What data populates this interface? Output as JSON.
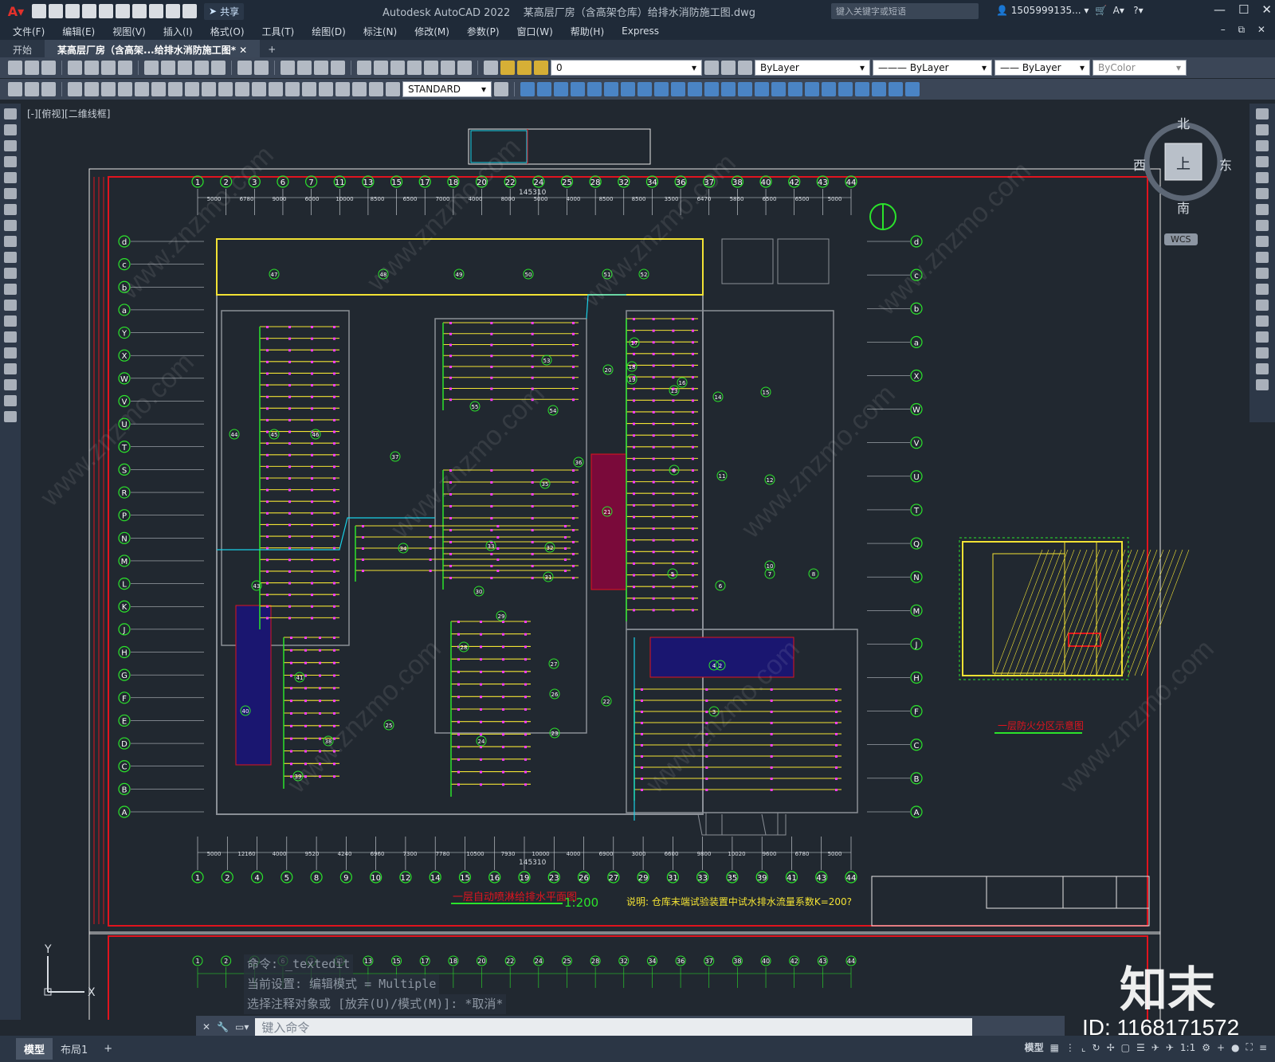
{
  "title_bar": {
    "app_title": "Autodesk AutoCAD 2022",
    "doc_title": "某高层厂房（含高架仓库）给排水消防施工图.dwg",
    "search_placeholder": "键入关键字或短语",
    "user": "1505999135...",
    "share_label": "共享"
  },
  "menu": {
    "items": [
      "文件(F)",
      "编辑(E)",
      "视图(V)",
      "插入(I)",
      "格式(O)",
      "工具(T)",
      "绘图(D)",
      "标注(N)",
      "修改(M)",
      "参数(P)",
      "窗口(W)",
      "帮助(H)",
      "Express"
    ]
  },
  "tabs": {
    "start": "开始",
    "doc": "某高层厂房（含高架...给排水消防施工图*"
  },
  "toolbar": {
    "layer_value": "0",
    "color_value": "ByLayer",
    "linetype_value": "ByLayer",
    "lineweight_value": "ByLayer",
    "plotstyle_value": "ByColor",
    "textstyle_value": "STANDARD"
  },
  "viewport": {
    "label": "[-][俯视][二维线框]",
    "compass": {
      "north": "北",
      "south": "南",
      "east": "东",
      "west": "西",
      "top": "上"
    },
    "wcs": "WCS"
  },
  "drawing": {
    "plan_title": "一层自动喷淋给排水平面图",
    "plan_scale": "1:200",
    "note": "说明: 仓库末端试验装置中试水排水流量系数K=200?",
    "inset_title": "一层防火分区示意图",
    "top_axes": [
      "1",
      "2",
      "3",
      "6",
      "7",
      "11",
      "13",
      "15",
      "17",
      "18",
      "20",
      "22",
      "24",
      "25",
      "28",
      "32",
      "34",
      "36",
      "37",
      "38",
      "40",
      "42",
      "43",
      "44"
    ],
    "bottom_axes": [
      "1",
      "2",
      "4",
      "5",
      "8",
      "9",
      "10",
      "12",
      "14",
      "15",
      "16",
      "19",
      "23",
      "26",
      "27",
      "29",
      "31",
      "33",
      "35",
      "39",
      "41",
      "43",
      "44"
    ],
    "left_axes": [
      "d",
      "c",
      "b",
      "a",
      "Y",
      "X",
      "W",
      "V",
      "U",
      "T",
      "S",
      "R",
      "P",
      "N",
      "M",
      "L",
      "K",
      "J",
      "H",
      "G",
      "F",
      "E",
      "D",
      "C",
      "B",
      "A"
    ],
    "right_axes": [
      "d",
      "c",
      "b",
      "a",
      "X",
      "W",
      "V",
      "U",
      "T",
      "Q",
      "N",
      "M",
      "J",
      "H",
      "F",
      "C",
      "B",
      "A"
    ],
    "top_dims": [
      "5000",
      "6780",
      "9000",
      "6000",
      "10000",
      "8500",
      "6500",
      "7000",
      "4000",
      "8000",
      "5000",
      "4000",
      "8500",
      "8500",
      "3500",
      "6470",
      "5860",
      "6500",
      "6500",
      "5000"
    ],
    "top_total": "145310",
    "bottom_dims": [
      "5000",
      "12160",
      "4000",
      "9520",
      "4240",
      "6960",
      "7300",
      "7780",
      "10500",
      "7930",
      "10000",
      "4000",
      "6900",
      "3000",
      "6600",
      "9800",
      "10020",
      "9600",
      "6780",
      "5000"
    ],
    "bottom_total": "145310",
    "room_numbers": [
      "47",
      "48",
      "49",
      "50",
      "51",
      "52",
      "53",
      "54",
      "55",
      "37",
      "44",
      "45",
      "46",
      "43",
      "40",
      "41",
      "38",
      "39",
      "36",
      "35",
      "34",
      "33",
      "32",
      "31",
      "30",
      "29",
      "28",
      "27",
      "26",
      "25",
      "24",
      "23",
      "22",
      "21",
      "20",
      "19",
      "18",
      "17",
      "16",
      "15",
      "14",
      "13",
      "12",
      "11",
      "10",
      "9",
      "8",
      "7",
      "6",
      "5",
      "4",
      "3",
      "2"
    ]
  },
  "command": {
    "history": [
      "命令: _textedit",
      "当前设置: 编辑模式 = Multiple",
      "选择注释对象或 [放弃(U)/模式(M)]: *取消*"
    ],
    "placeholder": "键入命令"
  },
  "status": {
    "model_tab": "模型",
    "layout_tab": "布局1",
    "model_label": "模型",
    "scale": "1:1"
  },
  "watermark": {
    "brand": "知末",
    "id": "ID: 1168171572",
    "site": "www.znzmo.com",
    "site_cn": "知末网"
  }
}
